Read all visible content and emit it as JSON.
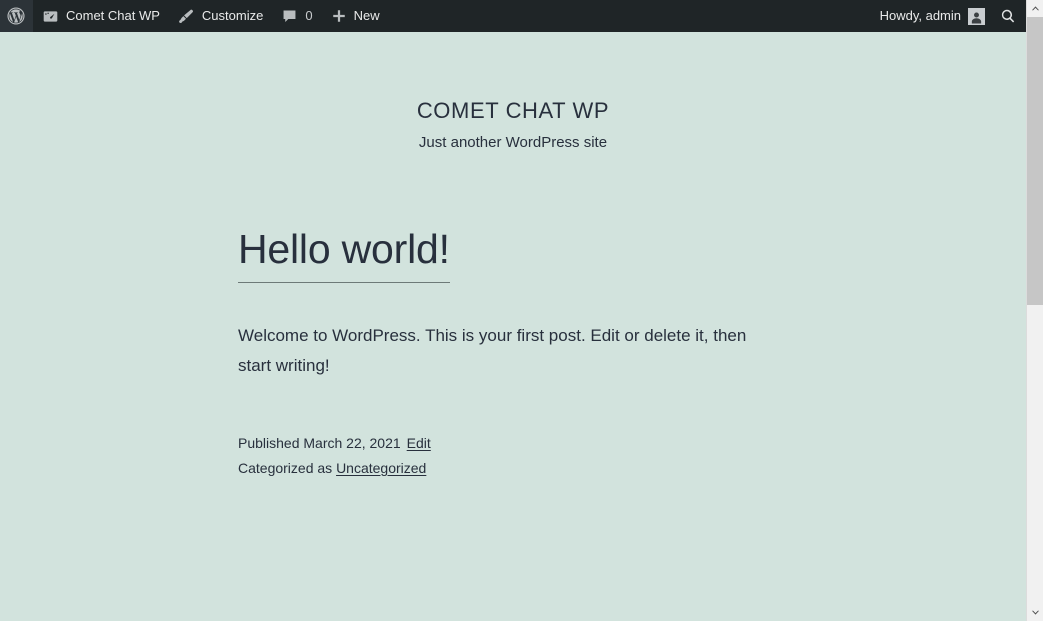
{
  "adminbar": {
    "logo_icon": "wordpress-logo-icon",
    "items": [
      {
        "icon": "dashboard-icon",
        "label": "Comet Chat WP"
      },
      {
        "icon": "paintbrush-icon",
        "label": "Customize"
      },
      {
        "icon": "comment-bubble-icon",
        "label": "0"
      },
      {
        "icon": "plus-icon",
        "label": "New"
      }
    ],
    "site_name": "Comet Chat WP",
    "customize_label": "Customize",
    "comment_count": "0",
    "new_label": "New",
    "howdy": "Howdy, admin",
    "avatar_icon": "user-avatar-icon",
    "search_icon": "search-icon"
  },
  "site": {
    "title": "COMET CHAT WP",
    "tagline": "Just another WordPress site"
  },
  "post": {
    "title": "Hello world!",
    "body": "Welcome to WordPress. This is your first post. Edit or delete it, then start writing!",
    "published_label": "Published March 22, 2021",
    "edit_link": "Edit",
    "category_prefix": "Categorized as",
    "category_link": "Uncategorized"
  },
  "scrollbar": {
    "up_icon": "chevron-up-icon",
    "down_icon": "chevron-down-icon"
  },
  "colors": {
    "background": "#d2e3dd",
    "adminbar": "#1f2527",
    "text": "#28303d",
    "scrollbar_thumb": "#c6c6c6"
  }
}
